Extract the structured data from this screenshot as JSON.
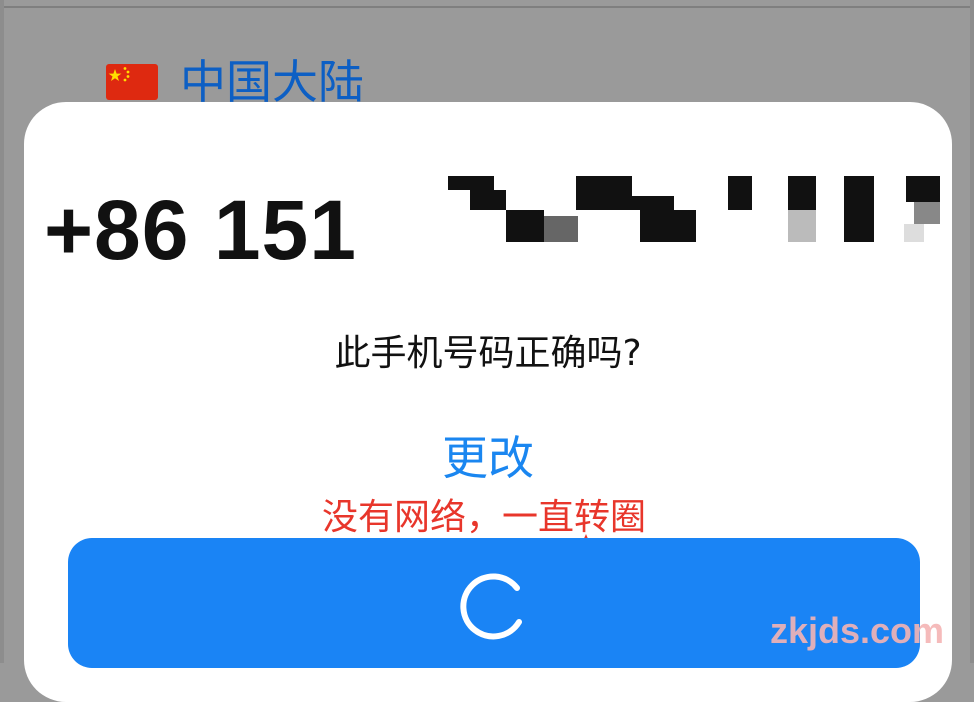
{
  "background": {
    "region": {
      "flag": "china-flag-icon",
      "label": "中国大陆"
    }
  },
  "dialog": {
    "phone": {
      "prefix_and_start": "+86 151"
    },
    "question": "此手机号码正确吗?",
    "change_label": "更改",
    "loading_icon": "spinner-icon"
  },
  "annotation": {
    "text": "没有网络，一直转圈",
    "color": "#e8362b"
  },
  "watermark": {
    "text": "zkjds.com"
  },
  "colors": {
    "accent": "#1a84f5",
    "link": "#1a86f0",
    "region_text": "#0d5fc4"
  }
}
